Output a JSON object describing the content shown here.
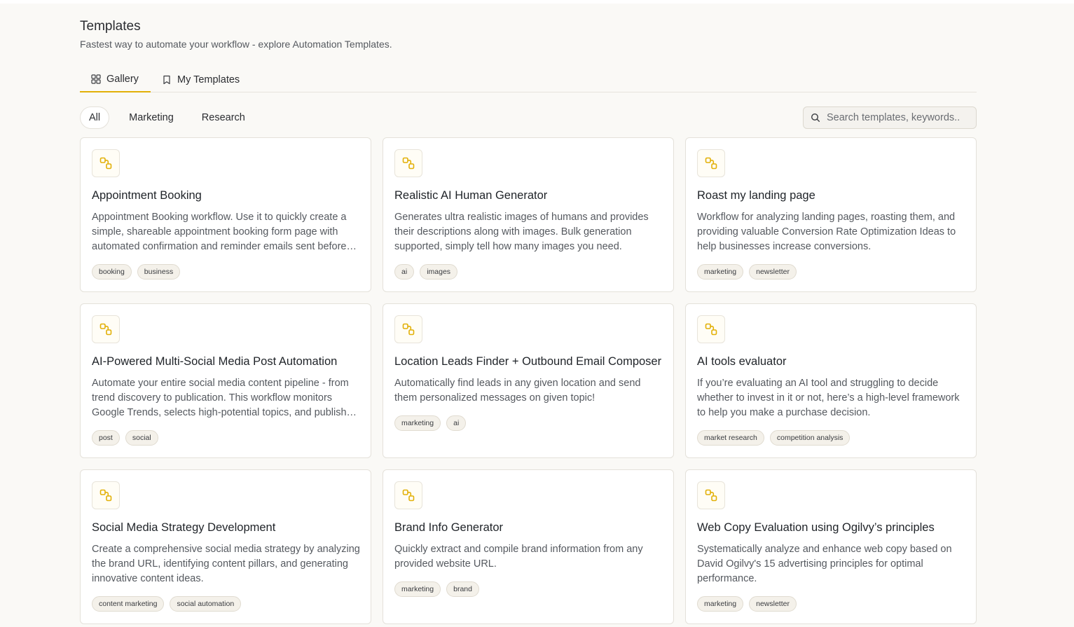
{
  "header": {
    "title": "Templates",
    "subtitle": "Fastest way to automate your workflow - explore Automation Templates."
  },
  "tabs": [
    {
      "label": "Gallery",
      "icon": "grid-icon",
      "active": true
    },
    {
      "label": "My Templates",
      "icon": "bookmark-icon",
      "active": false
    }
  ],
  "filters": [
    "All",
    "Marketing",
    "Research"
  ],
  "active_filter": "All",
  "search": {
    "placeholder": "Search templates, keywords.."
  },
  "accent_color": "#e2b008",
  "cards": [
    {
      "title": "Appointment Booking",
      "description": "Appointment Booking workflow. Use it to quickly create a simple, shareable appointment booking form page with automated confirmation and reminder emails sent before the appointment.",
      "tags": [
        "booking",
        "business"
      ]
    },
    {
      "title": "Realistic AI Human Generator",
      "description": "Generates ultra realistic images of humans and provides their descriptions along with images. Bulk generation supported, simply tell how many images you need.",
      "tags": [
        "ai",
        "images"
      ]
    },
    {
      "title": "Roast my landing page",
      "description": "Workflow for analyzing landing pages, roasting them, and providing valuable Conversion Rate Optimization Ideas to help businesses increase conversions.",
      "tags": [
        "marketing",
        "newsletter"
      ]
    },
    {
      "title": "AI-Powered Multi-Social Media Post Automation",
      "description": "Automate your entire social media content pipeline - from trend discovery to publication. This workflow monitors Google Trends, selects high-potential topics, and publishes posts.",
      "tags": [
        "post",
        "social"
      ]
    },
    {
      "title": "Location Leads Finder + Outbound Email Composer",
      "description": "Automatically find leads in any given location and send them personalized messages on given topic!",
      "tags": [
        "marketing",
        "ai"
      ]
    },
    {
      "title": "AI tools evaluator",
      "description": "If you’re evaluating an AI tool and struggling to decide whether to invest in it or not, here’s a high-level framework to help you make a purchase decision.",
      "tags": [
        "market research",
        "competition analysis"
      ]
    },
    {
      "title": "Social Media Strategy Development",
      "description": "Create a comprehensive social media strategy by analyzing the brand URL, identifying content pillars, and generating innovative content ideas.",
      "tags": [
        "content marketing",
        "social automation"
      ]
    },
    {
      "title": "Brand Info Generator",
      "description": "Quickly extract and compile brand information from any provided website URL.",
      "tags": [
        "marketing",
        "brand"
      ]
    },
    {
      "title": "Web Copy Evaluation using Ogilvy’s principles",
      "description": "Systematically analyze and enhance web copy based on David Ogilvy's 15 advertising principles for optimal performance.",
      "tags": [
        "marketing",
        "newsletter"
      ]
    }
  ]
}
